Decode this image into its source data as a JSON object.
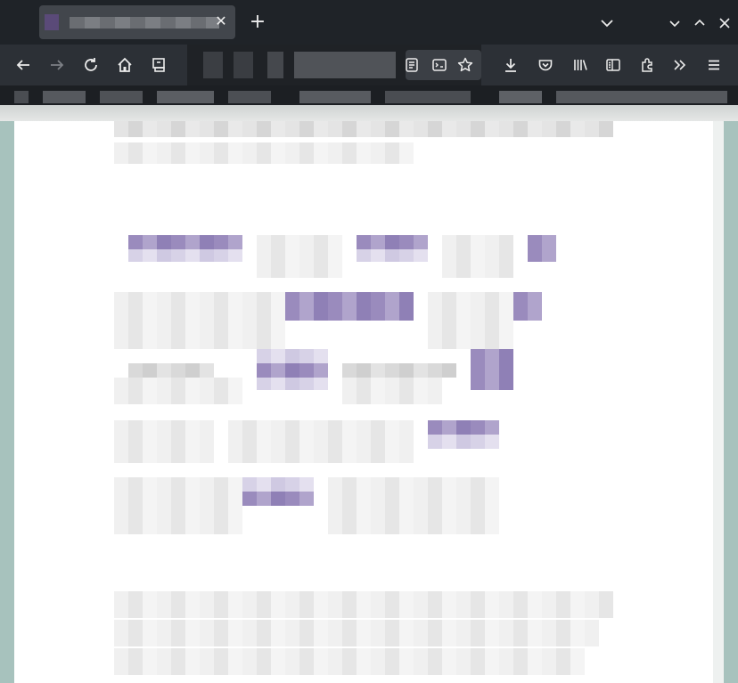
{
  "browser": {
    "tab": {
      "title": "",
      "close_glyph": "✕"
    },
    "new_tab_glyph": "+",
    "window_controls": {
      "list_all_tabs": "⌄",
      "minimize": "⌄",
      "maximize": "⌃",
      "close": "✕"
    },
    "url": "",
    "toolbar_icons": [
      "back-icon",
      "forward-icon",
      "reload-icon",
      "home-icon",
      "screenshot-icon",
      "reader-view-icon",
      "translate-icon",
      "bookmark-star-icon",
      "downloads-icon",
      "pocket-icon",
      "library-icon",
      "sidebar-icon",
      "extensions-icon",
      "overflow-icon",
      "menu-icon"
    ],
    "bookmarks": [
      "",
      "",
      "",
      "",
      "",
      "",
      "",
      "",
      ""
    ]
  },
  "page": {
    "intro_lines": [
      "",
      ""
    ],
    "rows": [
      {
        "cells": [
          {
            "text": "",
            "link": true
          },
          {
            "text": "",
            "link": false
          },
          {
            "text": "",
            "link": true
          },
          {
            "text": "",
            "link": false
          },
          {
            "text": "",
            "link": true
          }
        ]
      },
      {
        "cells": [
          {
            "text": "",
            "link": false
          },
          {
            "text": "",
            "link": true
          },
          {
            "text": "",
            "link": false
          },
          {
            "text": "",
            "link": true
          }
        ]
      },
      {
        "cells": [
          {
            "text": "",
            "link": false
          },
          {
            "text": "",
            "link": true
          },
          {
            "text": "",
            "link": false
          },
          {
            "text": "",
            "link": true
          }
        ]
      },
      {
        "cells": [
          {
            "text": "",
            "link": false
          },
          {
            "text": "",
            "link": false
          },
          {
            "text": "",
            "link": true
          }
        ]
      },
      {
        "cells": [
          {
            "text": "",
            "link": false
          },
          {
            "text": "",
            "link": true
          },
          {
            "text": "",
            "link": false
          }
        ]
      }
    ],
    "bottom_paragraph": [
      "",
      "",
      "",
      ""
    ]
  },
  "colors": {
    "tabbar_bg": "#1f2328",
    "toolbar_bg": "#2c3036",
    "page_bg": "#ffffff",
    "desktop_bg": "#a7c2bd",
    "link_accent": "#9a8bbd"
  }
}
